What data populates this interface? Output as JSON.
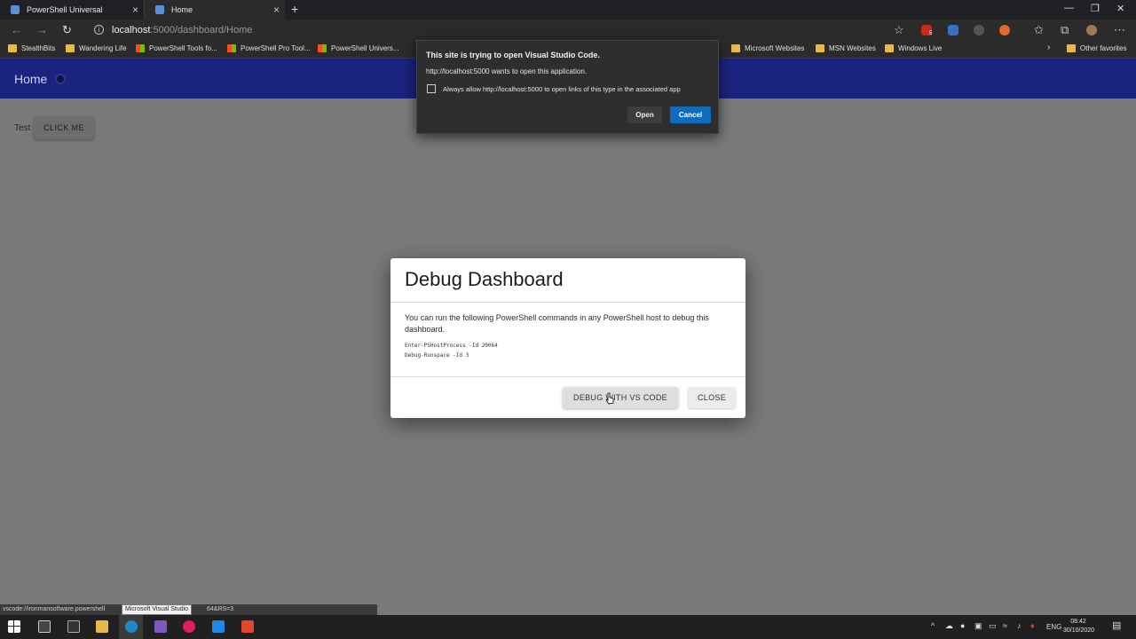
{
  "browser": {
    "tabs": [
      {
        "label": "PowerShell Universal"
      },
      {
        "label": "Home"
      }
    ],
    "url_host": "localhost",
    "url_path": ":5000/dashboard/Home",
    "extension_badge": "5",
    "favorites": [
      "StealthBits",
      "Wandering Life",
      "PowerShell Tools fo...",
      "PowerShell Pro Tool...",
      "PowerShell Univers...",
      "Microsoft Websites",
      "MSN Websites",
      "Windows Live",
      "Other favorites"
    ]
  },
  "app": {
    "title": "Home",
    "test_label": "Test",
    "click_me_label": "CLICK ME"
  },
  "dialog": {
    "title": "Debug Dashboard",
    "description": "You can run the following PowerShell commands in any PowerShell host to debug this dashboard.",
    "code_lines": [
      "Enter-PSHostProcess -Id 20064",
      "Debug-Runspace -Id 3"
    ],
    "debug_button": "DEBUG WITH VS CODE",
    "close_button": "CLOSE"
  },
  "prompt": {
    "title": "This site is trying to open Visual Studio Code.",
    "message": "http://localhost:5000 wants to open this application.",
    "checkbox_label": "Always allow http://localhost:5000 to open links of this type in the associated app",
    "open_button": "Open",
    "cancel_button": "Cancel"
  },
  "status": {
    "link_start": "vscode://ironmansoftware.powershell",
    "link_end": "64&RS=3",
    "tooltip": "Microsoft Visual Studio"
  },
  "taskbar": {
    "language": "ENG",
    "time": "08:42",
    "date": "30/10/2020"
  },
  "colors": {
    "appbar": "#1a237e",
    "cancel_accent": "#0f6cbd",
    "overlay": "#7a7a7a"
  }
}
